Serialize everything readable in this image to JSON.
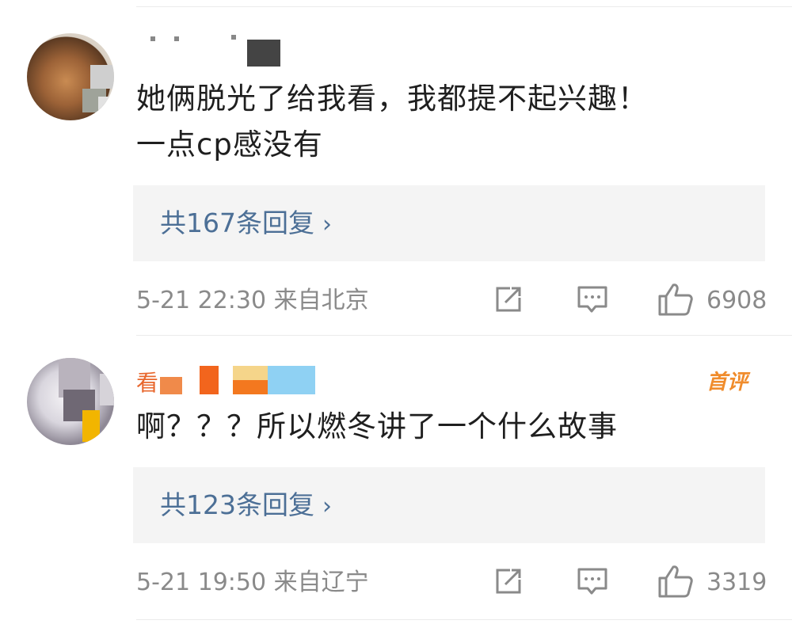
{
  "comments": [
    {
      "username": "",
      "text": "她俩脱光了给我看，我都提不起兴趣！\n一点cp感没有",
      "replies_label": "共167条回复",
      "chevron": "›",
      "time": "5-21 22:30",
      "location": "来自北京",
      "likes": "6908",
      "badge": ""
    },
    {
      "username": "看",
      "text": "啊？？？所以燃冬讲了一个什么故事",
      "replies_label": "共123条回复",
      "chevron": "›",
      "time": "5-21 19:50",
      "location": "来自辽宁",
      "likes": "3319",
      "badge": "首评"
    }
  ],
  "colors": {
    "link": "#4c6f96",
    "meta": "#8a8a8a",
    "badge": "#f08c2c",
    "reply_bg": "#f4f4f4"
  },
  "icons": [
    "share-icon",
    "comment-icon",
    "like-icon"
  ]
}
